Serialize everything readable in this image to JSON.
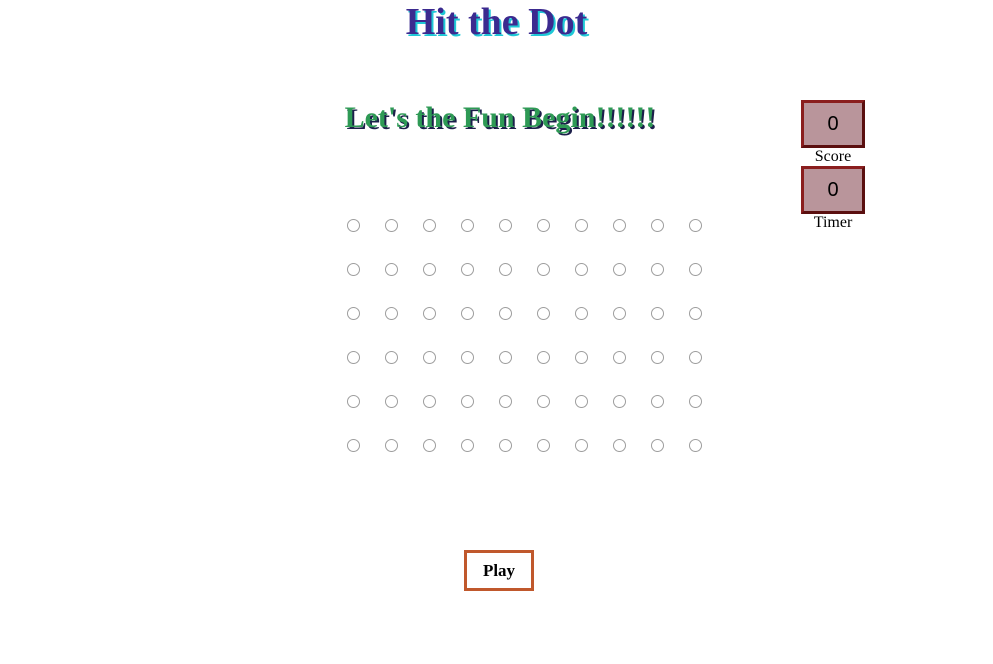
{
  "header": {
    "title": "Hit the Dot",
    "subtitle": "Let's the Fun Begin!!!!!!"
  },
  "stats": {
    "score_value": "0",
    "score_label": "Score",
    "timer_value": "0",
    "timer_label": "Timer"
  },
  "board": {
    "rows": 6,
    "columns": 10
  },
  "controls": {
    "play_label": "Play"
  },
  "colors": {
    "title": "#3b2a8f",
    "title_shadow": "#1ec8d6",
    "subtitle": "#2e9a55",
    "stat_box_bg": "#b9959b",
    "stat_box_border": "#8a1e1e",
    "play_border": "#c0582c"
  }
}
